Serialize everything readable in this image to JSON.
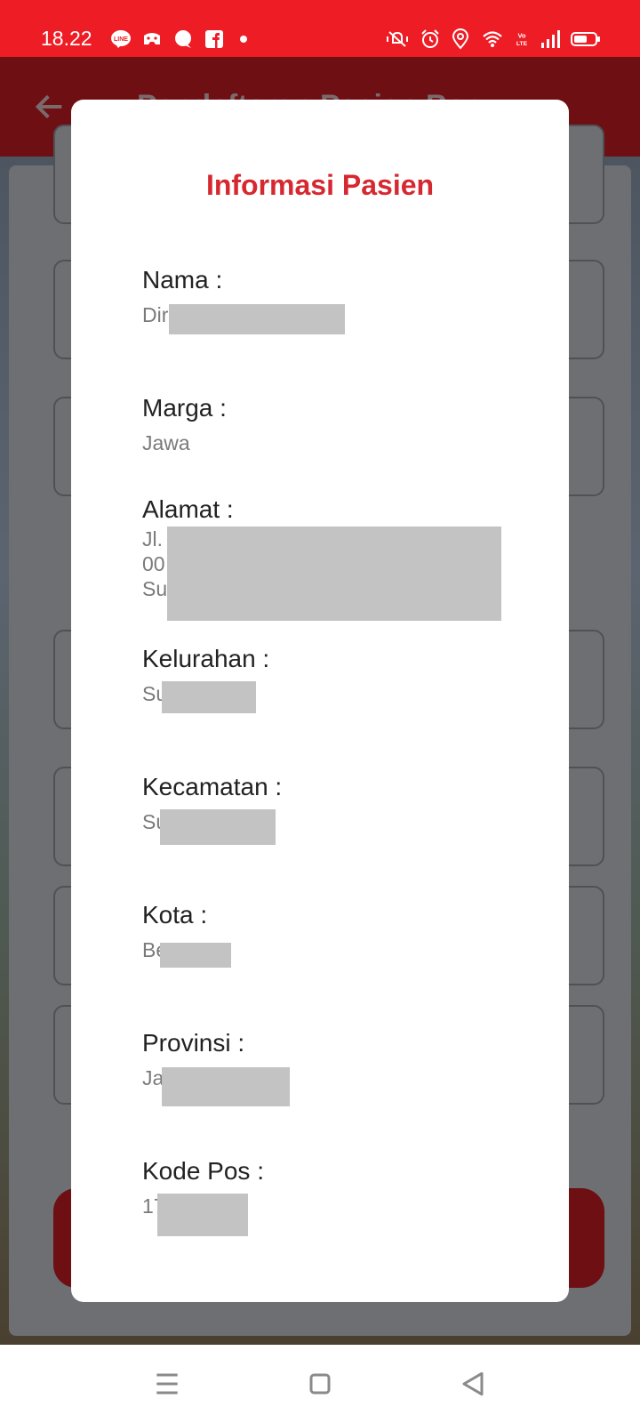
{
  "status_bar": {
    "time": "18.22",
    "app_icons": [
      "line-icon",
      "game-icon",
      "chat-bubble-icon",
      "facebook-icon"
    ],
    "system_icons": [
      "mute-vibrate-icon",
      "alarm-icon",
      "location-icon",
      "wifi-icon",
      "volte-icon",
      "signal-icon",
      "battery-icon"
    ],
    "system_label": "Vo LTE"
  },
  "app_bar": {
    "title": "Pendaftaran Pasien Baru"
  },
  "dialog": {
    "title": "Informasi Pasien",
    "fields": [
      {
        "label": "Nama :",
        "value": "Dir"
      },
      {
        "label": "Marga :",
        "value": "Jawa"
      },
      {
        "label": "Alamat :",
        "value": "Jl.\n00\nSu"
      },
      {
        "label": "Kelurahan :",
        "value": "Su"
      },
      {
        "label": "Kecamatan :",
        "value": "Su"
      },
      {
        "label": "Kota :",
        "value": "Be"
      },
      {
        "label": "Provinsi :",
        "value": "Ja"
      },
      {
        "label": "Kode Pos :",
        "value": "17"
      }
    ]
  },
  "colors": {
    "status_bar": "#ee1c25",
    "title_red": "#d62830",
    "redaction": "#c3c3c3"
  },
  "nav_bar": {
    "buttons": [
      "menu-icon",
      "home-icon",
      "back-triangle-icon"
    ]
  }
}
